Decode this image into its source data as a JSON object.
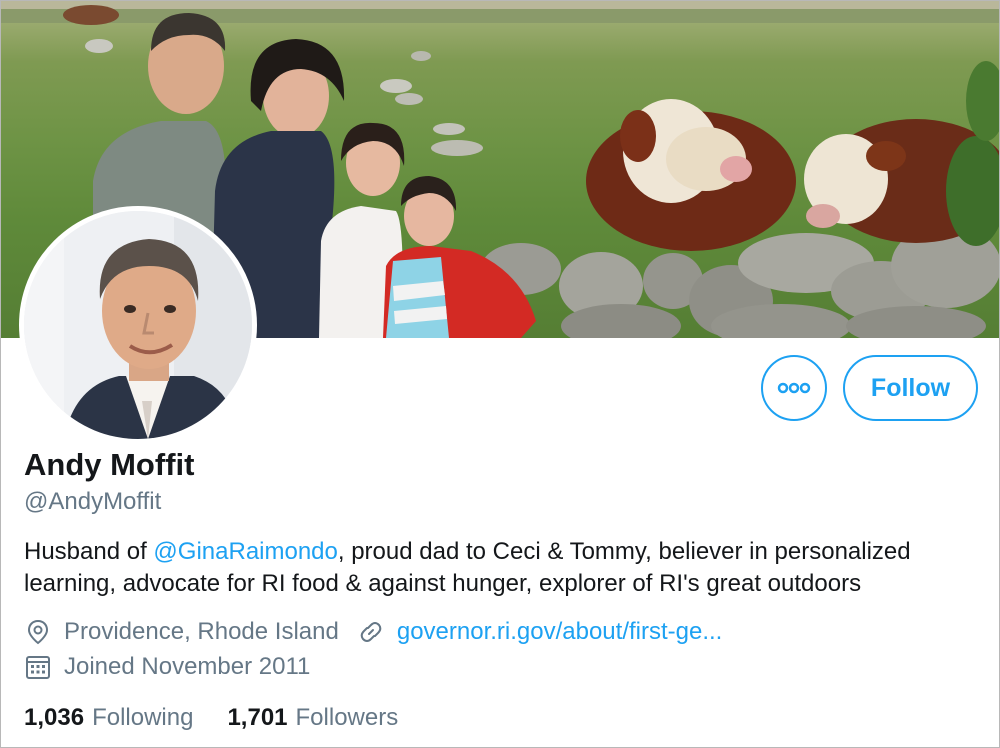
{
  "profile": {
    "name": "Andy Moffit",
    "handle": "@AndyMoffit",
    "bio_prefix": "Husband of ",
    "bio_mention": "@GinaRaimondo",
    "bio_line1_rest": ", proud dad to Ceci & Tommy, believer in personalized",
    "bio_line2": "learning, advocate for RI food & against hunger, explorer of RI's great outdoors",
    "location": "Providence, Rhode Island",
    "website": "governor.ri.gov/about/first-ge...",
    "joined": "Joined November 2011"
  },
  "actions": {
    "follow_label": "Follow",
    "more_icon": "more-horizontal-icon"
  },
  "stats": {
    "following_count": "1,036",
    "following_label": "Following",
    "followers_count": "1,701",
    "followers_label": "Followers"
  },
  "icons": {
    "location": "location-pin-icon",
    "link": "link-icon",
    "calendar": "calendar-icon"
  },
  "colors": {
    "accent": "#1da1f2",
    "secondary_text": "#657786",
    "primary_text": "#14171a"
  }
}
